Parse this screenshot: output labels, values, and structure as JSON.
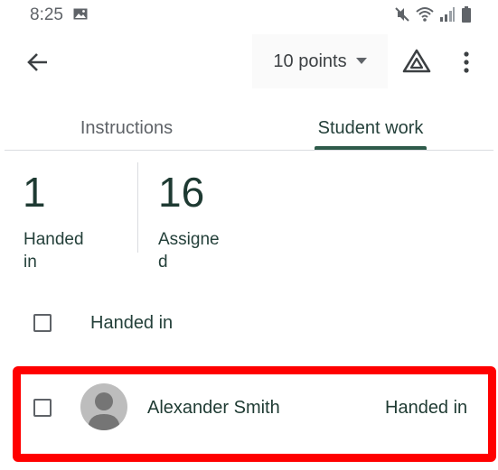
{
  "status_bar": {
    "time": "8:25",
    "icons": [
      "image-icon",
      "mute-icon",
      "wifi-icon",
      "signal-icon",
      "battery-icon"
    ]
  },
  "app_bar": {
    "points_label": "10 points",
    "icons": [
      "back-arrow-icon",
      "dropdown-caret-icon",
      "drive-icon",
      "more-vert-icon"
    ]
  },
  "tabs": [
    {
      "label": "Instructions",
      "selected": false
    },
    {
      "label": "Student work",
      "selected": true
    }
  ],
  "stats": [
    {
      "value": "1",
      "label_line1": "Handed",
      "label_line2": "in"
    },
    {
      "value": "16",
      "label_line1": "Assigne",
      "label_line2": "d"
    }
  ],
  "group": {
    "label": "Handed in",
    "checked": false
  },
  "students": [
    {
      "name": "Alexander Smith",
      "status": "Handed in",
      "checked": false
    }
  ],
  "colors": {
    "accent": "#2e5b4a",
    "highlight": "#ff0000",
    "text_dark": "#1f3b33",
    "text_muted": "#5f6368"
  }
}
